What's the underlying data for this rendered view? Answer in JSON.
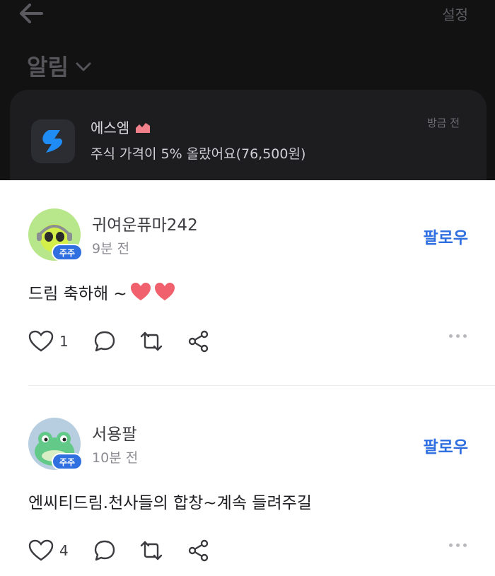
{
  "header": {
    "settings_label": "설정",
    "title": "알림"
  },
  "notification": {
    "sender": "에스엠",
    "message": "주식 가격이 5% 올랐어요(76,500원)",
    "time": "방금 전"
  },
  "posts": [
    {
      "username": "귀여운퓨마242",
      "badge": "주주",
      "time": "9분 전",
      "follow_label": "팔로우",
      "text": "드림 축하해 ~",
      "like_count": "1"
    },
    {
      "username": "서용팔",
      "badge": "주주",
      "time": "10분 전",
      "follow_label": "팔로우",
      "text": "엔씨티드림.천사들의 합창~계속 들려주길",
      "like_count": "4"
    }
  ],
  "colors": {
    "accent": "#2f6fe0",
    "heart": "#f0616d",
    "dark_bg": "#121213",
    "card_bg": "#1d1d20"
  }
}
